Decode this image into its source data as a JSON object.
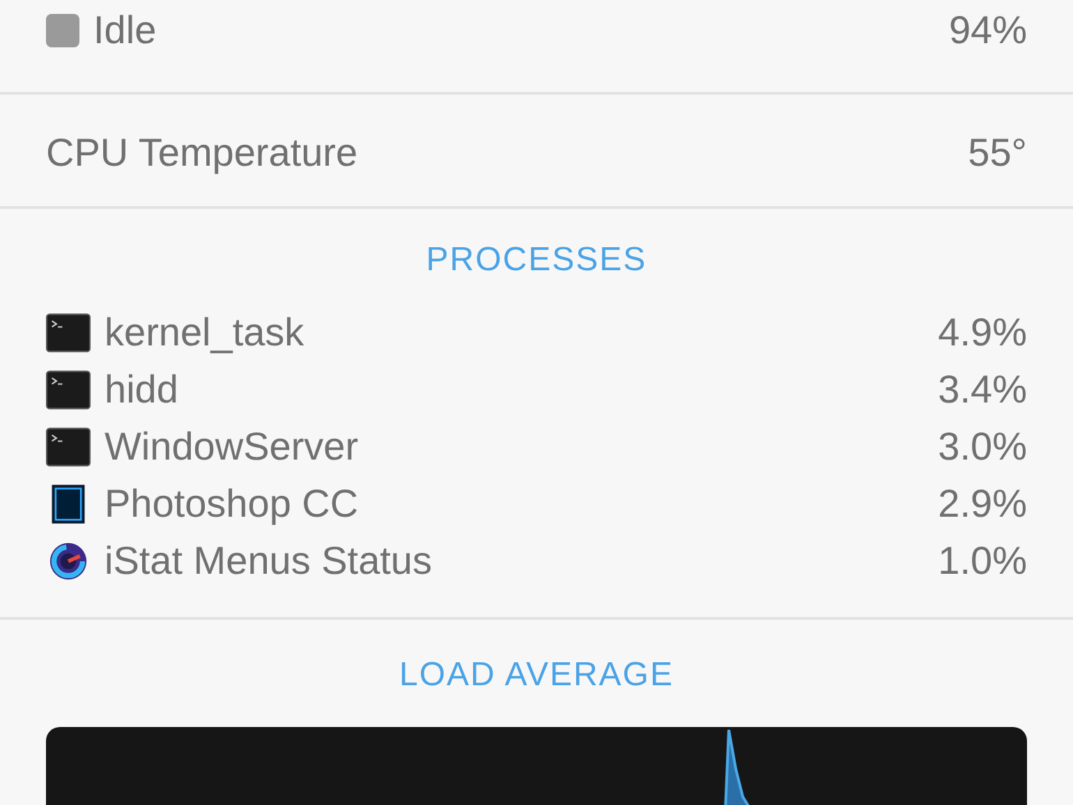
{
  "cpu_usage": [
    {
      "label": "Idle",
      "value": "94%",
      "color": "#9a9a9a"
    }
  ],
  "temperature": {
    "label": "CPU Temperature",
    "value": "55°"
  },
  "processes": {
    "title": "PROCESSES",
    "items": [
      {
        "name": "kernel_task",
        "value": "4.9%",
        "kind": "terminal"
      },
      {
        "name": "hidd",
        "value": "3.4%",
        "kind": "terminal"
      },
      {
        "name": "WindowServer",
        "value": "3.0%",
        "kind": "terminal"
      },
      {
        "name": "Photoshop CC",
        "value": "2.9%",
        "kind": "photoshop"
      },
      {
        "name": "iStat Menus Status",
        "value": "1.0%",
        "kind": "gauge"
      }
    ]
  },
  "load_average": {
    "title": "LOAD AVERAGE"
  }
}
